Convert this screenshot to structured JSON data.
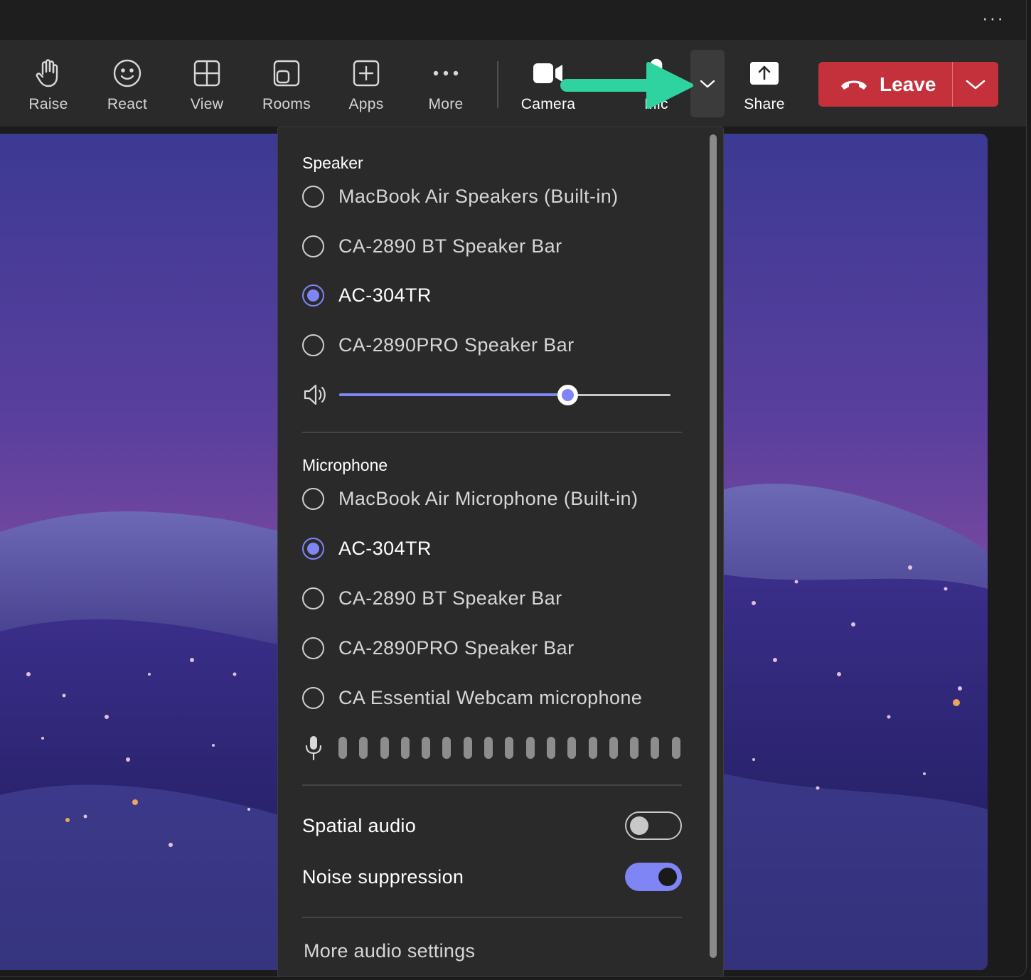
{
  "titlebar": {
    "more_label": "···"
  },
  "toolbar": {
    "raise": "Raise",
    "react": "React",
    "view": "View",
    "rooms": "Rooms",
    "apps": "Apps",
    "more": "More",
    "camera": "Camera",
    "mic": "Mic",
    "share": "Share",
    "leave": "Leave"
  },
  "colors": {
    "accent": "#7f85f5",
    "leave": "#c4313a",
    "annotation_arrow": "#2fd39f"
  },
  "panel": {
    "speaker": {
      "title": "Speaker",
      "options": [
        {
          "label": "MacBook Air Speakers (Built-in)",
          "selected": false
        },
        {
          "label": "CA-2890 BT Speaker Bar",
          "selected": false
        },
        {
          "label": "AC-304TR",
          "selected": true
        },
        {
          "label": "CA-2890PRO Speaker Bar",
          "selected": false
        }
      ],
      "volume_fraction": 0.69
    },
    "microphone": {
      "title": "Microphone",
      "options": [
        {
          "label": "MacBook Air Microphone (Built-in)",
          "selected": false
        },
        {
          "label": "AC-304TR",
          "selected": true
        },
        {
          "label": "CA-2890 BT Speaker Bar",
          "selected": false
        },
        {
          "label": "CA-2890PRO Speaker Bar",
          "selected": false
        },
        {
          "label": "CA Essential Webcam microphone",
          "selected": false
        }
      ],
      "level_bar_count": 17
    },
    "spatial_audio": {
      "label": "Spatial audio",
      "on": false
    },
    "noise_suppression": {
      "label": "Noise suppression",
      "on": true
    },
    "more_settings": "More audio settings"
  }
}
